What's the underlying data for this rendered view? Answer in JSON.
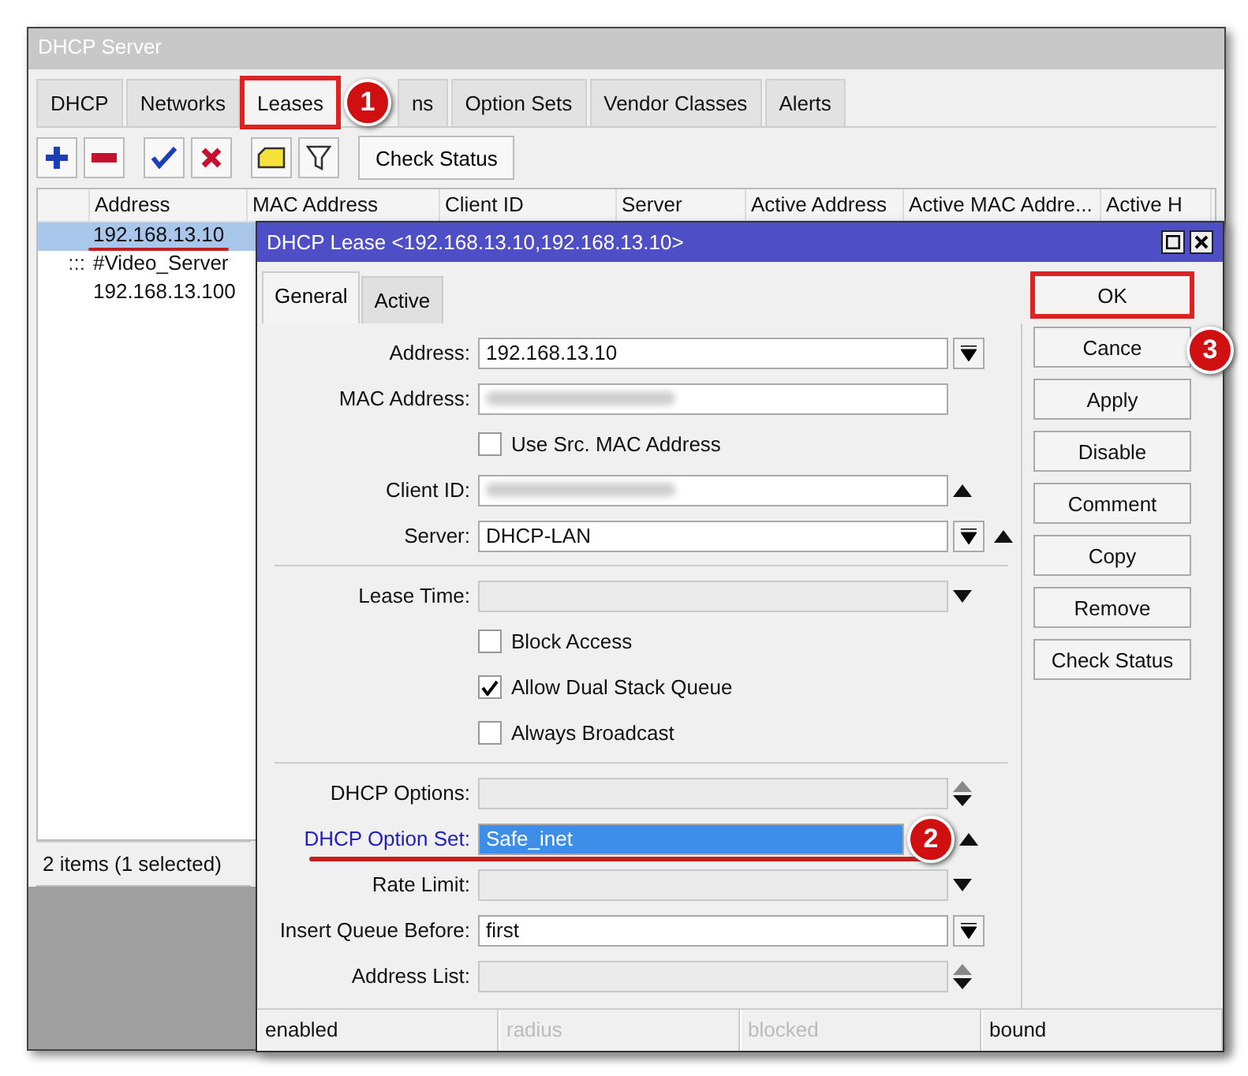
{
  "window": {
    "title": "DHCP Server"
  },
  "tabs": [
    {
      "label": "DHCP",
      "selected": false,
      "marked": false
    },
    {
      "label": "Networks",
      "selected": false,
      "marked": false
    },
    {
      "label": "Leases",
      "selected": true,
      "marked": true,
      "badge": "1"
    },
    {
      "label": "ns",
      "selected": false,
      "marked": false
    },
    {
      "label": "Option Sets",
      "selected": false,
      "marked": false
    },
    {
      "label": "Vendor Classes",
      "selected": false,
      "marked": false
    },
    {
      "label": "Alerts",
      "selected": false,
      "marked": false
    }
  ],
  "toolbar": {
    "tools": [
      {
        "kind": "add"
      },
      {
        "kind": "remove"
      },
      {
        "kind": "enable"
      },
      {
        "kind": "disable"
      },
      {
        "kind": "comment"
      },
      {
        "kind": "filter"
      }
    ],
    "button": "Check Status"
  },
  "table": {
    "columns": [
      "Address",
      "MAC Address",
      "Client ID",
      "Server",
      "Active Address",
      "Active MAC Addre...",
      "Active H"
    ],
    "rows": [
      {
        "kind": "lease",
        "address": "192.168.13.10",
        "selected": true,
        "underlined": true
      },
      {
        "kind": "comment",
        "marker": ":::",
        "address": "#Video_Server",
        "selected": false,
        "underlined": false
      },
      {
        "kind": "lease",
        "address": "192.168.13.100",
        "selected": false,
        "underlined": false
      }
    ],
    "status": "2 items (1 selected)"
  },
  "dialog": {
    "title": "DHCP Lease <192.168.13.10,192.168.13.10>",
    "tabs": [
      {
        "label": "General",
        "selected": true
      },
      {
        "label": "Active",
        "selected": false
      }
    ],
    "rows": [
      {
        "kind": "field",
        "label": "Address:",
        "value": "192.168.13.10",
        "enabled": true,
        "blurred": false,
        "selected": false,
        "controls": [
          {
            "kind": "dropdown"
          }
        ]
      },
      {
        "kind": "field",
        "label": "MAC Address:",
        "enabled": true,
        "blurred": true,
        "selected": false,
        "controls": []
      },
      {
        "kind": "checkbox",
        "label": "Use Src. MAC Address",
        "checked": false
      },
      {
        "kind": "field",
        "label": "Client ID:",
        "enabled": true,
        "blurred": true,
        "selected": false,
        "controls": [
          {
            "kind": "up"
          }
        ]
      },
      {
        "kind": "field",
        "label": "Server:",
        "value": "DHCP-LAN",
        "enabled": true,
        "blurred": false,
        "selected": false,
        "controls": [
          {
            "kind": "dropdown"
          },
          {
            "kind": "up"
          }
        ]
      },
      {
        "kind": "separator"
      },
      {
        "kind": "field",
        "label": "Lease Time:",
        "enabled": false,
        "blurred": false,
        "selected": false,
        "controls": [
          {
            "kind": "down"
          }
        ]
      },
      {
        "kind": "checkbox",
        "label": "Block Access",
        "checked": false
      },
      {
        "kind": "checkbox",
        "label": "Allow Dual Stack Queue",
        "checked": true
      },
      {
        "kind": "checkbox",
        "label": "Always Broadcast",
        "checked": false
      },
      {
        "kind": "separator"
      },
      {
        "kind": "field",
        "label": "DHCP Options:",
        "enabled": false,
        "blurred": false,
        "selected": false,
        "controls": [
          {
            "kind": "updown"
          }
        ]
      },
      {
        "kind": "field",
        "label": "DHCP Option Set:",
        "value": "Safe_inet",
        "enabled": true,
        "blurred": false,
        "selected": true,
        "underlined": true,
        "badge": "2",
        "controls": [
          {
            "kind": "up"
          }
        ]
      },
      {
        "kind": "field",
        "label": "Rate Limit:",
        "enabled": false,
        "blurred": false,
        "selected": false,
        "controls": [
          {
            "kind": "down"
          }
        ]
      },
      {
        "kind": "field",
        "label": "Insert Queue Before:",
        "value": "first",
        "enabled": true,
        "blurred": false,
        "selected": false,
        "controls": [
          {
            "kind": "dropdown"
          }
        ]
      },
      {
        "kind": "field",
        "label": "Address List:",
        "enabled": false,
        "blurred": false,
        "selected": false,
        "controls": [
          {
            "kind": "updown"
          }
        ]
      }
    ],
    "buttons": [
      {
        "label": "OK",
        "marked": true
      },
      {
        "label": "Cance",
        "marked": false,
        "badge": "3"
      },
      {
        "label": "Apply",
        "marked": false
      },
      {
        "label": "Disable",
        "marked": false
      },
      {
        "label": "Comment",
        "marked": false
      },
      {
        "label": "Copy",
        "marked": false
      },
      {
        "label": "Remove",
        "marked": false
      },
      {
        "label": "Check Status",
        "marked": false
      }
    ],
    "status": [
      {
        "text": "enabled",
        "enabled": true
      },
      {
        "text": "radius",
        "enabled": false
      },
      {
        "text": "blocked",
        "enabled": false
      },
      {
        "text": "bound",
        "enabled": true
      }
    ]
  }
}
